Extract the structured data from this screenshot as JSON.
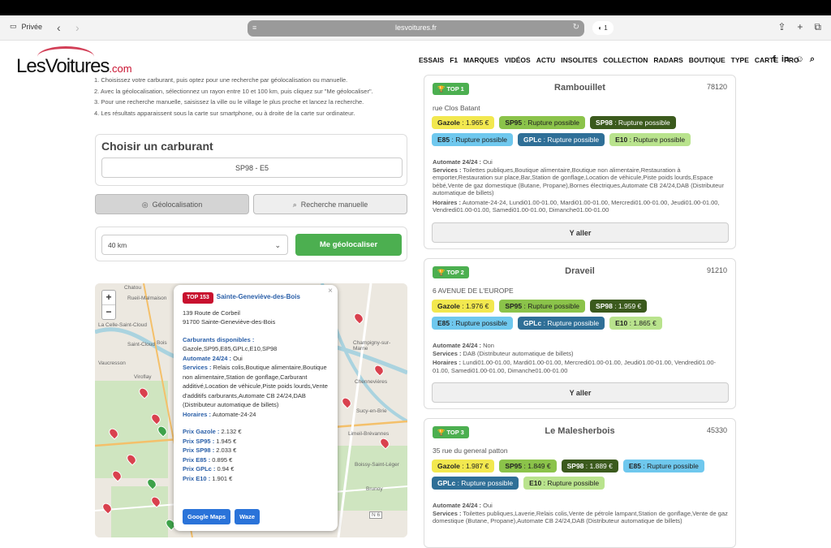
{
  "browser": {
    "private_label": "Privée",
    "url": "lesvoitures.fr",
    "tab_count": "1"
  },
  "site": {
    "logo_main": "LesVoitures",
    "logo_suffix": ".com",
    "menu": [
      "ESSAIS",
      "F1",
      "MARQUES",
      "VIDÉOS",
      "ACTU",
      "INSOLITES",
      "COLLECTION",
      "RADARS",
      "BOUTIQUE",
      "TYPE",
      "CARTE",
      "PRO"
    ]
  },
  "instructions": [
    "1. Choisissez votre carburant, puis optez pour une recherche par géolocalisation ou manuelle.",
    "2. Avec la géolocalisation, sélectionnez un rayon entre 10 et 100 km, puis cliquez sur \"Me géolocaliser\".",
    "3. Pour une recherche manuelle, saisissez la ville ou le village le plus proche et lancez la recherche.",
    "4. Les résultats apparaissent sous la carte sur smartphone, ou à droite de la carte sur ordinateur."
  ],
  "fuel_picker": {
    "title": "Choisir un carburant",
    "selected": "SP98 - E5"
  },
  "search_tabs": {
    "geo": "Géolocalisation",
    "manual": "Recherche manuelle"
  },
  "geo": {
    "radius": "40 km",
    "button": "Me géolocaliser"
  },
  "map": {
    "labels": [
      "Chatou",
      "Rueil-Malmaison",
      "La Celle-Saint-Cloud",
      "Saint-Cloud",
      "Vaucresson",
      "Viroflay",
      "Bois",
      "Champigny-sur-Marne",
      "Chennevières",
      "Sucy-en-Brie",
      "Limeil-Brévannes",
      "Brunoy",
      "Boissy-Saint-Léger",
      "N 6"
    ],
    "popup": {
      "rank": "TOP 153",
      "name": "Sainte-Geneviève-des-Bois",
      "address1": "139 Route de Corbeil",
      "address2": "91700 Sainte-Geneviève-des-Bois",
      "fuels_label": "Carburants disponibles :",
      "fuels": "Gazole,SP95,E85,GPLc,E10,SP98",
      "h24_label": "Automate 24/24 :",
      "h24": "Oui",
      "services_label": "Services :",
      "services": "Relais colis,Boutique alimentaire,Boutique non alimentaire,Station de gonflage,Carburant additivé,Location de véhicule,Piste poids lourds,Vente d'additifs carburants,Automate CB 24/24,DAB (Distributeur automatique de billets)",
      "hours_label": "Horaires :",
      "hours": "Automate-24-24",
      "prices": [
        {
          "label": "Prix Gazole :",
          "value": "2.132 €"
        },
        {
          "label": "Prix SP95 :",
          "value": "1.945 €"
        },
        {
          "label": "Prix SP98 :",
          "value": "2.033 €"
        },
        {
          "label": "Prix E85 :",
          "value": "0.895 €"
        },
        {
          "label": "Prix GPLc :",
          "value": "0.94 €"
        },
        {
          "label": "Prix E10 :",
          "value": "1.901 €"
        }
      ],
      "gmaps": "Google Maps",
      "waze": "Waze"
    }
  },
  "stations": [
    {
      "rank": "TOP 1",
      "city": "Rambouillet",
      "zip": "78120",
      "address": "rue Clos Batant",
      "fuels": [
        {
          "cls": "gazole",
          "name": "Gazole",
          "value": "1.965 €"
        },
        {
          "cls": "sp95",
          "name": "SP95",
          "value": "Rupture possible"
        },
        {
          "cls": "sp98",
          "name": "SP98",
          "value": "Rupture possible"
        },
        {
          "cls": "e85",
          "name": "E85",
          "value": "Rupture possible"
        },
        {
          "cls": "gplc",
          "name": "GPLc",
          "value": "Rupture possible"
        },
        {
          "cls": "e10",
          "name": "E10",
          "value": "Rupture possible"
        }
      ],
      "h24": "Oui",
      "services": "Toilettes publiques,Boutique alimentaire,Boutique non alimentaire,Restauration à emporter,Restauration sur place,Bar,Station de gonflage,Location de véhicule,Piste poids lourds,Espace bébé,Vente de gaz domestique (Butane, Propane),Bornes électriques,Automate CB 24/24,DAB (Distributeur automatique de billets)",
      "hours": "Automate-24-24, Lundi01.00-01.00, Mardi01.00-01.00, Mercredi01.00-01.00, Jeudi01.00-01.00, Vendredi01.00-01.00, Samedi01.00-01.00, Dimanche01.00-01.00",
      "button": "Y aller"
    },
    {
      "rank": "TOP 2",
      "city": "Draveil",
      "zip": "91210",
      "address": "6 AVENUE DE L'EUROPE",
      "fuels": [
        {
          "cls": "gazole",
          "name": "Gazole",
          "value": "1.976 €"
        },
        {
          "cls": "sp95",
          "name": "SP95",
          "value": "Rupture possible"
        },
        {
          "cls": "sp98",
          "name": "SP98",
          "value": "1.959 €"
        },
        {
          "cls": "e85",
          "name": "E85",
          "value": "Rupture possible"
        },
        {
          "cls": "gplc",
          "name": "GPLc",
          "value": "Rupture possible"
        },
        {
          "cls": "e10",
          "name": "E10",
          "value": "1.865 €"
        }
      ],
      "h24": "Non",
      "services": "DAB (Distributeur automatique de billets)",
      "hours": "Lundi01.00-01.00, Mardi01.00-01.00, Mercredi01.00-01.00, Jeudi01.00-01.00, Vendredi01.00-01.00, Samedi01.00-01.00, Dimanche01.00-01.00",
      "button": "Y aller"
    },
    {
      "rank": "TOP 3",
      "city": "Le Malesherbois",
      "zip": "45330",
      "address": "35 rue du general patton",
      "fuels": [
        {
          "cls": "gazole",
          "name": "Gazole",
          "value": "1.987 €"
        },
        {
          "cls": "sp95",
          "name": "SP95",
          "value": "1.849 €"
        },
        {
          "cls": "sp98",
          "name": "SP98",
          "value": "1.889 €"
        },
        {
          "cls": "e85",
          "name": "E85",
          "value": "Rupture possible"
        },
        {
          "cls": "gplc",
          "name": "GPLc",
          "value": "Rupture possible"
        },
        {
          "cls": "e10",
          "name": "E10",
          "value": "Rupture possible"
        }
      ],
      "h24": "Oui",
      "services": "Toilettes publiques,Laverie,Relais colis,Vente de pétrole lampant,Station de gonflage,Vente de gaz domestique (Butane, Propane),Automate CB 24/24,DAB (Distributeur automatique de billets)",
      "hours": "",
      "button": "Y aller"
    }
  ],
  "labels": {
    "h24": "Automate 24/24 :",
    "services": "Services :",
    "hours": "Horaires :"
  }
}
